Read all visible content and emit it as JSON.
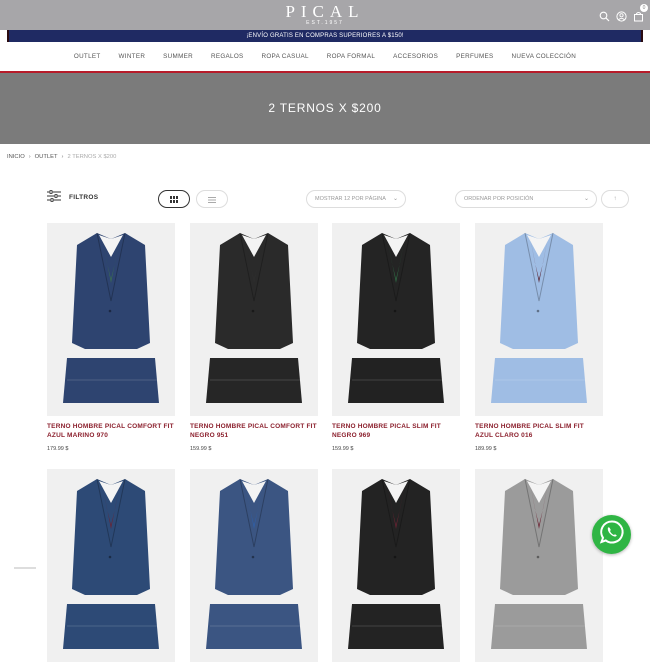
{
  "header": {
    "logo_text": "PICAL",
    "logo_sub": "EST.1957",
    "cart_count": "0"
  },
  "promo": {
    "text": "¡ENVÍO GRATIS EN COMPRAS SUPERIORES A $150!"
  },
  "nav": {
    "items": [
      "OUTLET",
      "WINTER",
      "SUMMER",
      "REGALOS",
      "ROPA CASUAL",
      "ROPA FORMAL",
      "ACCESORIOS",
      "PERFUMES",
      "NUEVA COLECCIÓN"
    ]
  },
  "banner": {
    "title": "2 TERNOS X $200"
  },
  "breadcrumb": {
    "home": "INICIO",
    "outlet": "OUTLET",
    "current": "2 TERNOS X $200"
  },
  "toolbar": {
    "filters_label": "FILTROS",
    "show_select": "MOSTRAR 12 POR PÁGINA",
    "order_select": "ORDENAR POR POSICIÓN"
  },
  "products": [
    {
      "name": "TERNO HOMBRE PICAL COMFORT FIT AZUL MARINO 970",
      "price": "179.99 $",
      "jacket": "#2e4470",
      "lining": "#3b6e4f",
      "shirt": "#f4f4f4",
      "pants": "#2e4470"
    },
    {
      "name": "TERNO HOMBRE PICAL COMFORT FIT NEGRO 951",
      "price": "159.99 $",
      "jacket": "#2a2a2a",
      "lining": "#2e2e2e",
      "shirt": "#f4f4f4",
      "pants": "#262626"
    },
    {
      "name": "TERNO HOMBRE PICAL SLIM FIT NEGRO 969",
      "price": "159.99 $",
      "jacket": "#242424",
      "lining": "#2f6d45",
      "shirt": "#f4f4f4",
      "pants": "#222222"
    },
    {
      "name": "TERNO HOMBRE PICAL SLIM FIT AZUL CLARO 016",
      "price": "189.99 $",
      "jacket": "#9fbde4",
      "lining": "#5a2430",
      "shirt": "#f4f4f4",
      "pants": "#9fbde4"
    },
    {
      "name": "",
      "price": "",
      "jacket": "#2d4a76",
      "lining": "#6b2333",
      "shirt": "#f4f4f4",
      "pants": "#2d4a76"
    },
    {
      "name": "",
      "price": "",
      "jacket": "#3b5582",
      "lining": "#2f5fa8",
      "shirt": "#f4f4f4",
      "pants": "#3b5582"
    },
    {
      "name": "",
      "price": "",
      "jacket": "#232323",
      "lining": "#6b2333",
      "shirt": "#f4f4f4",
      "pants": "#232323"
    },
    {
      "name": "",
      "price": "",
      "jacket": "#9b9b9b",
      "lining": "#6b2333",
      "shirt": "#f4f4f4",
      "pants": "#9b9b9b"
    }
  ]
}
